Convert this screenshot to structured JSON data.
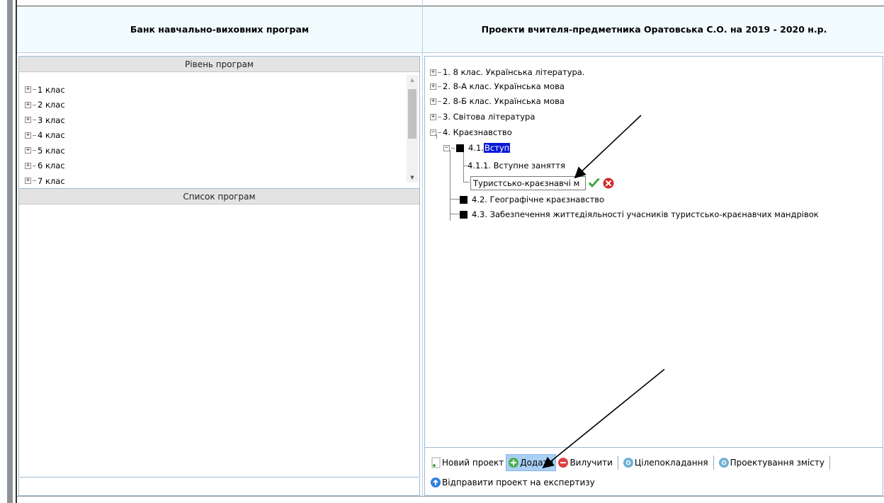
{
  "left_header": {
    "title": "Банк навчально-виховних програм"
  },
  "right_header": {
    "title": "Проекти вчителя-предметника Оратовська С.О. на 2019 - 2020 н.р."
  },
  "level_section": {
    "title": "Рівень програм",
    "items": [
      "1 клас",
      "2 клас",
      "3 клас",
      "4 клас",
      "5 клас",
      "6 клас",
      "7 клас"
    ]
  },
  "list_section": {
    "title": "Список програм"
  },
  "project_tree": {
    "items": [
      {
        "label": "1. 8 клас. Українська література."
      },
      {
        "label": "2. 8-А клас. Українська мова"
      },
      {
        "label": "2. 8-Б клас. Українська мова"
      },
      {
        "label": "3. Світова література"
      },
      {
        "label": "4. Краєзнавство"
      },
      {
        "label": "4.1. ",
        "selected": "Вступ"
      },
      {
        "label": "4.1.1. Вступне заняття"
      },
      {
        "label": "4.2. Географічне краєзнавство"
      },
      {
        "label": "4.3. Забезпечення життєдіяльності учасників туристсько-краєнавчих мандрівок"
      }
    ],
    "edit_value": "Туристсько-краєзнавчі м"
  },
  "toolbar": {
    "new_project": "Новий проект",
    "add": "Додати",
    "remove": "Вилучити",
    "goals": "Цілепокладання",
    "content_design": "Проектування змісту",
    "send_expertise": "Відправити проект на експертизу"
  },
  "colors": {
    "header_bg": "#f2fbfd",
    "selection": "#0a19d6",
    "active_button": "#a9cff5",
    "border": "#9fbbd3"
  }
}
